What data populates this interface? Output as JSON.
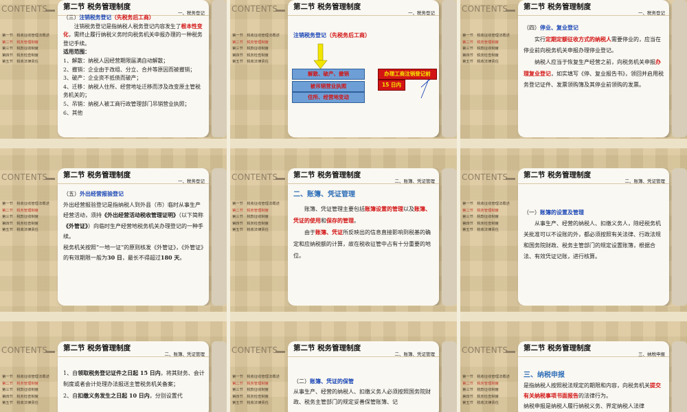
{
  "contents_label": "CONTENTS",
  "chapter_title": "第二节 税务管理制度",
  "toc": [
    "第一节　税收征收管理法概述",
    "第二节　税务管理制度",
    "第三节　税款征收制度",
    "第四节　税务检查制度",
    "第五节　税收法律责任"
  ],
  "s1": {
    "tag": "一、税务登记",
    "heading_num": "（三）",
    "heading_blue": "注销税务登记",
    "heading_red": "（先税务后工商）",
    "p1a": "注销税务登记是指纳税人税务登记内容发生了",
    "p1red": "根本性变化",
    "p1b": "，需终止履行纳税义务时向税务机关申报办理的一种税务登记手续。",
    "scope": "适用范围：",
    "items": [
      "1、解散：纳税人因经营期限届满自动解散；",
      "2、撤销：企业由于改组、分立、合并等原因而被撤销；",
      "3、破产：企业资不抵债而破产；",
      "4、迁移：纳税人住所、经营地址迁移而涉及改变原主管税务机关的；",
      "5、吊销：纳税人被工商行政管理部门吊销营业执照；",
      "6、其他"
    ]
  },
  "s2": {
    "tag": "一、税务登记",
    "heading_blue": "注销税务登记",
    "heading_red": "（先税务后工商）",
    "boxes": [
      "解散、破产、撤销",
      "被吊销营业执照",
      "住所、经营地变动"
    ],
    "result1": "办理工商注销登记前",
    "result2": "15 日内"
  },
  "s3": {
    "tag": "一、税务登记",
    "heading_num": "（四）",
    "heading_blue": "停业、复业登记",
    "p1a": "实行",
    "p1red": "定期定额征收方式的纳税人",
    "p1b": "需要停业的，应当在停业前向税务机关申报办理停业登记。",
    "p2a": "纳税人应当于恢复生产经营之前，向税务机关申报",
    "p2red": "办理复业登记",
    "p2b": "，如实填写《停、复业报告书》，领回并启用税务登记证件、发票领购簿及其停业前领购的发票。"
  },
  "s4": {
    "tag": "一、税务登记",
    "heading_num": "（五）",
    "heading_blue": "外出经营报验登记",
    "p1a": "外出经营报验登记是指纳税人到外县（市）临时从事生产经营活动，须持",
    "p1b": "《外出经营活动税收管理证明》",
    "p1c": "（以下简称",
    "p1d": "《外管证》",
    "p1e": "）向临时生产经营地税务机关办理登记的一种手续。",
    "p2a": "税务机关按照“一地一证”的原则核发《外管证》，《外管证》的有效期限一般为",
    "p2b": "30 日",
    "p2c": "，最长不得超过",
    "p2d": "180 天",
    "p2e": "。"
  },
  "s5": {
    "tag": "二、账簿、凭证管理",
    "heading": "二、账簿、凭证管理",
    "p1a": "账簿、凭证管理主要包括",
    "p1r1": "账簿设置的管理",
    "p1b": "以及",
    "p1r2": "账簿、凭证的使用",
    "p1c": "和",
    "p1r3": "保存的管理",
    "p1d": "。",
    "p2a": "由于",
    "p2r": "账簿、凭证",
    "p2b": "所反映出的信息直接影响到税基的确定和应纳税额的计算，故在税收征管中占有十分重要的地位。"
  },
  "s6": {
    "tag": "二、账簿、凭证管理",
    "heading_num": "（一）",
    "heading_blue": "账簿的设置及管理",
    "p1": "从事生产、经营的纳税人、扣缴义务人，除经税务机关批准可以不设账的外，都必须按照有关法律、行政法规和国务院财政、税务主管部门的规定设置账簿，根据合法、有效凭证记账，进行核算。"
  },
  "s7": {
    "tag": "二、账簿、凭证管理",
    "i1a": "1、自",
    "i1b": "领取税务登记证件之日起 15 日内",
    "i1c": "，将其财务、会计制度或者会计处理办法报送主管税务机关备案；",
    "i2a": "2、自",
    "i2b": "扣缴义务发生之日起 10 日内",
    "i2c": "，分别设置代"
  },
  "s8": {
    "tag": "二、账簿、凭证管理",
    "heading_num": "（二）",
    "heading_blue": "账簿、凭证的保管",
    "p1": "从事生产、经营的纳税人、扣缴义务人必须按照国务院财政、税务主管部门的规定妥善保管账簿、记"
  },
  "s9": {
    "tag": "三、纳税申报",
    "heading": "三、纳税申报",
    "p1a": "是指纳税人按照税法规定的期限和内容，向税务机关",
    "p1red": "提交有关纳税事项书面报告",
    "p1b": "的法律行为。",
    "p2": "纳税申报是纳税人履行纳税义务、界定纳税人法律"
  }
}
